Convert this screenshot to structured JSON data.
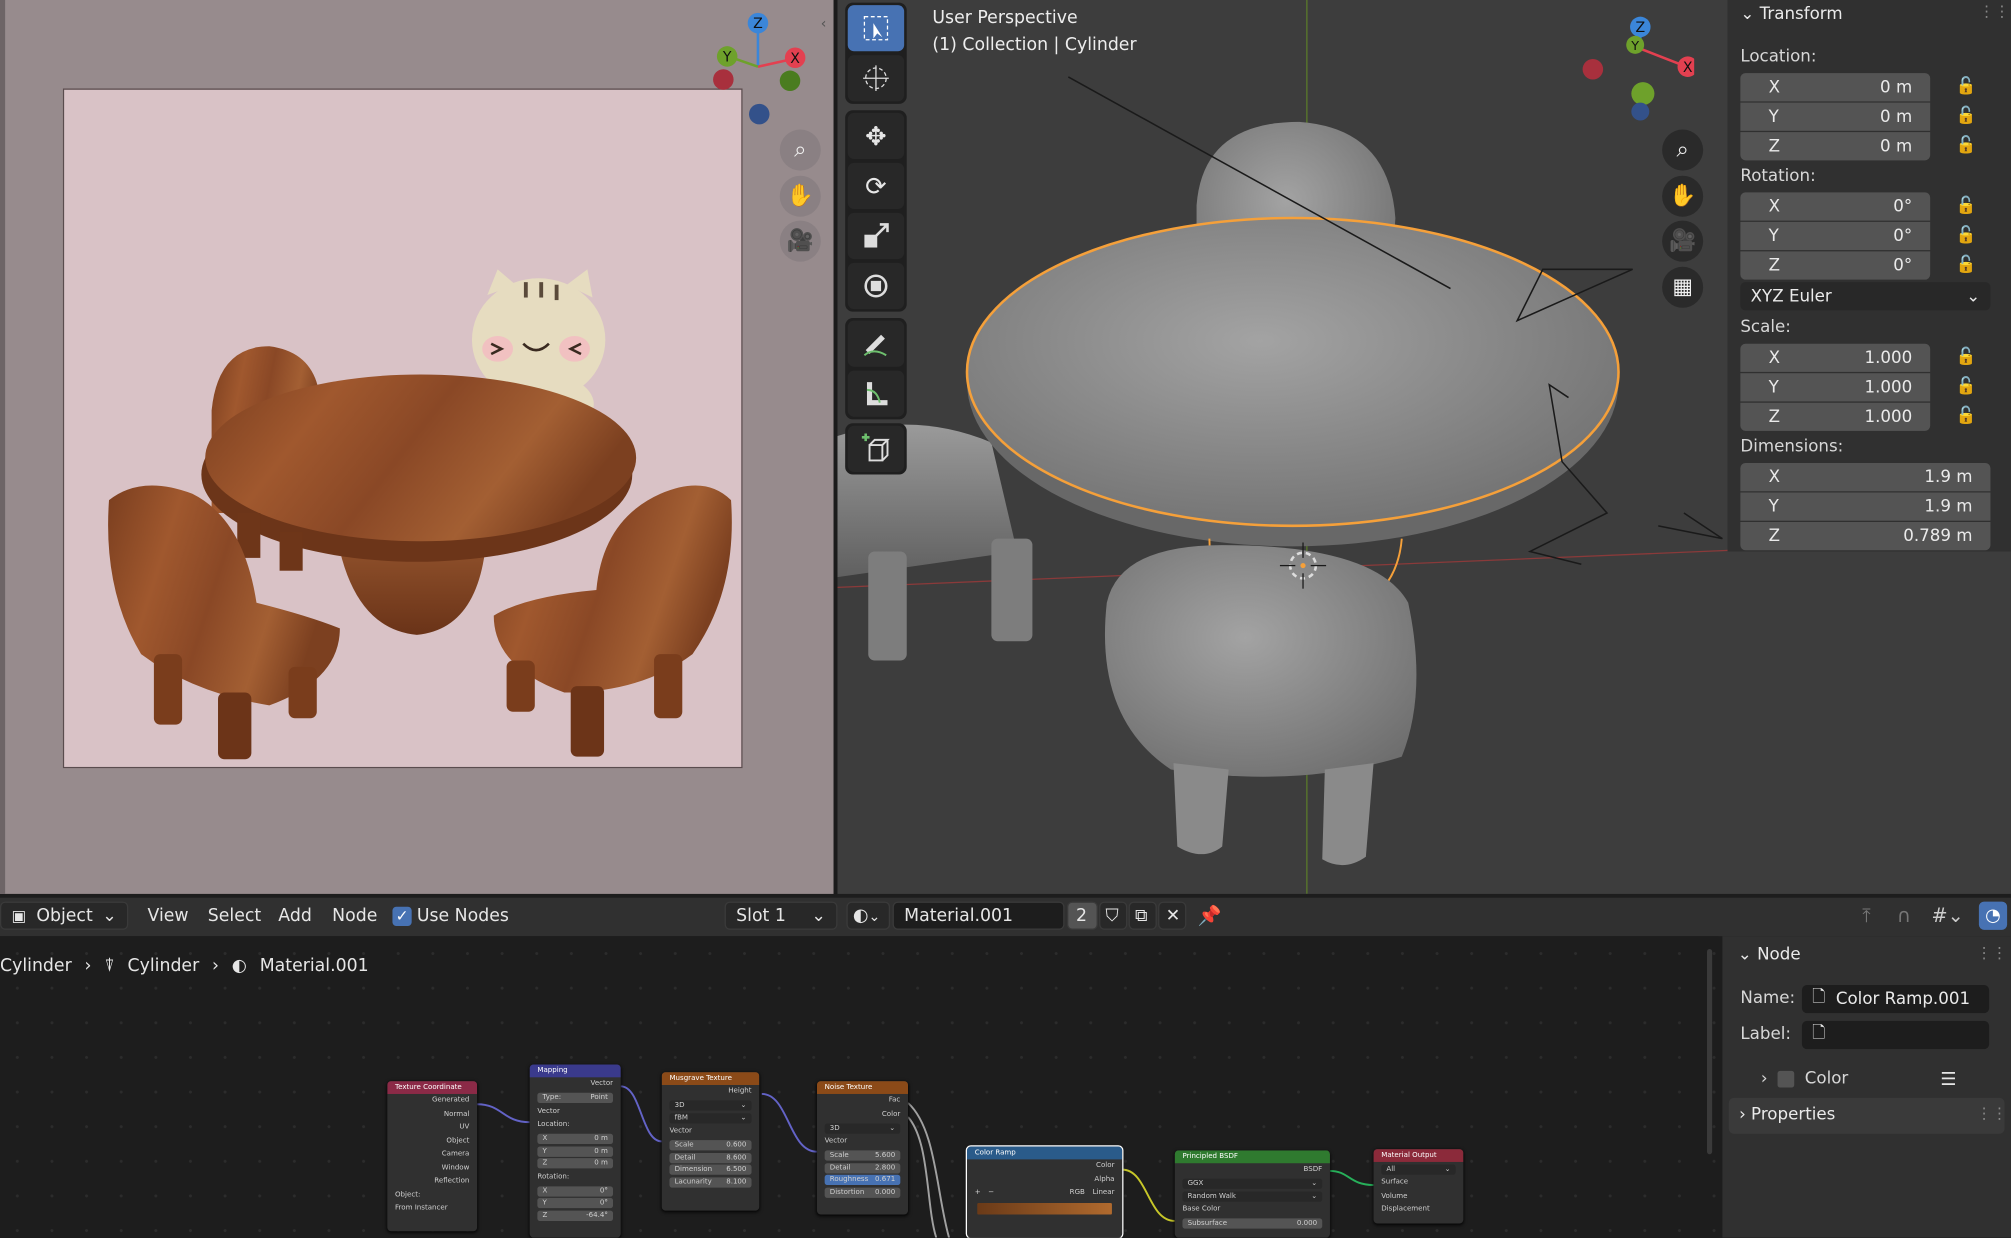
{
  "viewport": {
    "title": "User Perspective",
    "subtitle": "(1) Collection | Cylinder",
    "gizmo_axes": [
      "Z",
      "Y",
      "X"
    ]
  },
  "transform_panel": {
    "header": "Transform",
    "location_label": "Location:",
    "location": [
      {
        "axis": "X",
        "value": "0 m"
      },
      {
        "axis": "Y",
        "value": "0 m"
      },
      {
        "axis": "Z",
        "value": "0 m"
      }
    ],
    "rotation_label": "Rotation:",
    "rotation": [
      {
        "axis": "X",
        "value": "0°"
      },
      {
        "axis": "Y",
        "value": "0°"
      },
      {
        "axis": "Z",
        "value": "0°"
      }
    ],
    "rotation_mode": "XYZ Euler",
    "scale_label": "Scale:",
    "scale": [
      {
        "axis": "X",
        "value": "1.000"
      },
      {
        "axis": "Y",
        "value": "1.000"
      },
      {
        "axis": "Z",
        "value": "1.000"
      }
    ],
    "dimensions_label": "Dimensions:",
    "dimensions": [
      {
        "axis": "X",
        "value": "1.9 m"
      },
      {
        "axis": "Y",
        "value": "1.9 m"
      },
      {
        "axis": "Z",
        "value": "0.789 m"
      }
    ]
  },
  "node_header": {
    "mode": "Object",
    "menus": [
      "View",
      "Select",
      "Add",
      "Node"
    ],
    "use_nodes_label": "Use Nodes",
    "use_nodes_checked": true,
    "slot": "Slot 1",
    "material": "Material.001",
    "users": "2"
  },
  "breadcrumb": [
    "Cylinder",
    "Cylinder",
    "Material.001"
  ],
  "node_panel": {
    "header": "Node",
    "name_label": "Name:",
    "name_value": "Color Ramp.001",
    "label_label": "Label:",
    "label_value": "",
    "color_label": "Color",
    "properties_label": "Properties"
  },
  "nodes": {
    "texcoord": {
      "title": "Texture Coordinate",
      "color": "#8b2a47",
      "outputs": [
        "Generated",
        "Normal",
        "UV",
        "Object",
        "Camera",
        "Window",
        "Reflection"
      ],
      "object_label": "Object:",
      "from_instancer": "From Instancer"
    },
    "mapping": {
      "title": "Mapping",
      "color": "#3a3a8c",
      "out": "Vector",
      "type_label": "Type:",
      "type": "Point",
      "in": "Vector",
      "location_label": "Location:",
      "location": [
        [
          "X",
          "0 m"
        ],
        [
          "Y",
          "0 m"
        ],
        [
          "Z",
          "0 m"
        ]
      ],
      "rotation_label": "Rotation:",
      "rotation": [
        [
          "X",
          "0°"
        ],
        [
          "Y",
          "0°"
        ],
        [
          "Z",
          "-64.4°"
        ]
      ]
    },
    "musgrave": {
      "title": "Musgrave Texture",
      "color": "#8b4a18",
      "out": "Height",
      "dims": "3D",
      "type": "fBM",
      "in": "Vector",
      "fields": [
        [
          "Scale",
          "0.600"
        ],
        [
          "Detail",
          "8.600"
        ],
        [
          "Dimension",
          "6.500"
        ],
        [
          "Lacunarity",
          "8.100"
        ]
      ]
    },
    "noise": {
      "title": "Noise Texture",
      "color": "#8b4a18",
      "outputs": [
        "Fac",
        "Color"
      ],
      "dims": "3D",
      "in": "Vector",
      "fields": [
        [
          "Scale",
          "5.600"
        ],
        [
          "Detail",
          "2.800"
        ],
        [
          "Roughness",
          "0.671"
        ],
        [
          "Distortion",
          "0.000"
        ]
      ]
    },
    "colorramp": {
      "title": "Color Ramp",
      "color": "#2a5b8a",
      "outputs": [
        "Color",
        "Alpha"
      ],
      "mode": "RGB",
      "interp": "Linear"
    },
    "bsdf": {
      "title": "Principled BSDF",
      "color": "#2f7a2f",
      "out": "BSDF",
      "dist": "GGX",
      "sss": "Random Walk",
      "base": "Base Color",
      "sub": "Subsurface",
      "sub_val": "0.000"
    },
    "output": {
      "title": "Material Output",
      "color": "#8b2a3a",
      "target": "All",
      "inputs": [
        "Surface",
        "Volume",
        "Displacement"
      ]
    }
  },
  "colors": {
    "accent": "#4772b3",
    "selection": "#f5a03a",
    "x_axis": "#e34050",
    "y_axis": "#6ea12b",
    "z_axis": "#3b86d9"
  }
}
